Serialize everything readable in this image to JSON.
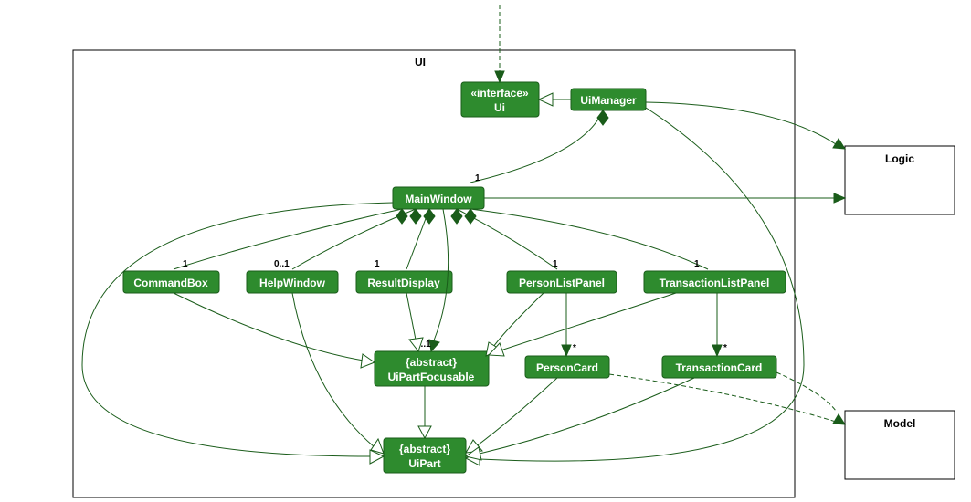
{
  "package": {
    "name": "UI"
  },
  "external": {
    "logic": "Logic",
    "model": "Model"
  },
  "classes": {
    "ui": {
      "stereotype": "«interface»",
      "name": "Ui"
    },
    "uiManager": {
      "name": "UiManager"
    },
    "mainWindow": {
      "name": "MainWindow"
    },
    "commandBox": {
      "name": "CommandBox"
    },
    "helpWindow": {
      "name": "HelpWindow"
    },
    "resultDisplay": {
      "name": "ResultDisplay"
    },
    "personListPanel": {
      "name": "PersonListPanel"
    },
    "transactionListPanel": {
      "name": "TransactionListPanel"
    },
    "uiPartFocusable": {
      "stereotype": "{abstract}",
      "name": "UiPartFocusable"
    },
    "personCard": {
      "name": "PersonCard"
    },
    "transactionCard": {
      "name": "TransactionCard"
    },
    "uiPart": {
      "stereotype": "{abstract}",
      "name": "UiPart"
    }
  },
  "multiplicities": {
    "mainWindow": "1",
    "commandBox": "1",
    "helpWindow": "0..1",
    "resultDisplay": "1",
    "personListPanel": "1",
    "transactionListPanel": "1",
    "uiPartFocusable": "0..1",
    "personCard": "*",
    "transactionCard": "*"
  },
  "chart_data": {
    "type": "uml-class-diagram",
    "package": "UI",
    "external_components": [
      "Logic",
      "Model"
    ],
    "classes": [
      {
        "id": "Ui",
        "stereotype": "interface"
      },
      {
        "id": "UiManager"
      },
      {
        "id": "MainWindow"
      },
      {
        "id": "CommandBox"
      },
      {
        "id": "HelpWindow"
      },
      {
        "id": "ResultDisplay"
      },
      {
        "id": "PersonListPanel"
      },
      {
        "id": "TransactionListPanel"
      },
      {
        "id": "UiPartFocusable",
        "stereotype": "abstract"
      },
      {
        "id": "PersonCard"
      },
      {
        "id": "TransactionCard"
      },
      {
        "id": "UiPart",
        "stereotype": "abstract"
      }
    ],
    "relationships": [
      {
        "from": "external-top",
        "to": "Ui",
        "type": "dependency"
      },
      {
        "from": "UiManager",
        "to": "Ui",
        "type": "realization"
      },
      {
        "from": "UiManager",
        "to": "MainWindow",
        "type": "composition",
        "multiplicity": "1"
      },
      {
        "from": "UiManager",
        "to": "Logic",
        "type": "association"
      },
      {
        "from": "MainWindow",
        "to": "Logic",
        "type": "association"
      },
      {
        "from": "MainWindow",
        "to": "CommandBox",
        "type": "composition",
        "multiplicity": "1"
      },
      {
        "from": "MainWindow",
        "to": "HelpWindow",
        "type": "composition",
        "multiplicity": "0..1"
      },
      {
        "from": "MainWindow",
        "to": "ResultDisplay",
        "type": "composition",
        "multiplicity": "1"
      },
      {
        "from": "MainWindow",
        "to": "PersonListPanel",
        "type": "composition",
        "multiplicity": "1"
      },
      {
        "from": "MainWindow",
        "to": "TransactionListPanel",
        "type": "composition",
        "multiplicity": "1"
      },
      {
        "from": "MainWindow",
        "to": "UiPartFocusable",
        "type": "association",
        "multiplicity": "0..1"
      },
      {
        "from": "MainWindow",
        "to": "UiPart",
        "type": "inheritance"
      },
      {
        "from": "CommandBox",
        "to": "UiPartFocusable",
        "type": "inheritance"
      },
      {
        "from": "HelpWindow",
        "to": "UiPart",
        "type": "inheritance"
      },
      {
        "from": "ResultDisplay",
        "to": "UiPartFocusable",
        "type": "inheritance"
      },
      {
        "from": "PersonListPanel",
        "to": "UiPartFocusable",
        "type": "inheritance"
      },
      {
        "from": "PersonListPanel",
        "to": "PersonCard",
        "type": "association",
        "multiplicity": "*"
      },
      {
        "from": "TransactionListPanel",
        "to": "UiPartFocusable",
        "type": "inheritance"
      },
      {
        "from": "TransactionListPanel",
        "to": "TransactionCard",
        "type": "association",
        "multiplicity": "*"
      },
      {
        "from": "UiPartFocusable",
        "to": "UiPart",
        "type": "inheritance"
      },
      {
        "from": "PersonCard",
        "to": "UiPart",
        "type": "inheritance"
      },
      {
        "from": "PersonCard",
        "to": "Model",
        "type": "dependency"
      },
      {
        "from": "TransactionCard",
        "to": "UiPart",
        "type": "inheritance"
      },
      {
        "from": "TransactionCard",
        "to": "Model",
        "type": "dependency"
      },
      {
        "from": "UiManager",
        "to": "UiPart",
        "type": "inheritance"
      }
    ]
  }
}
